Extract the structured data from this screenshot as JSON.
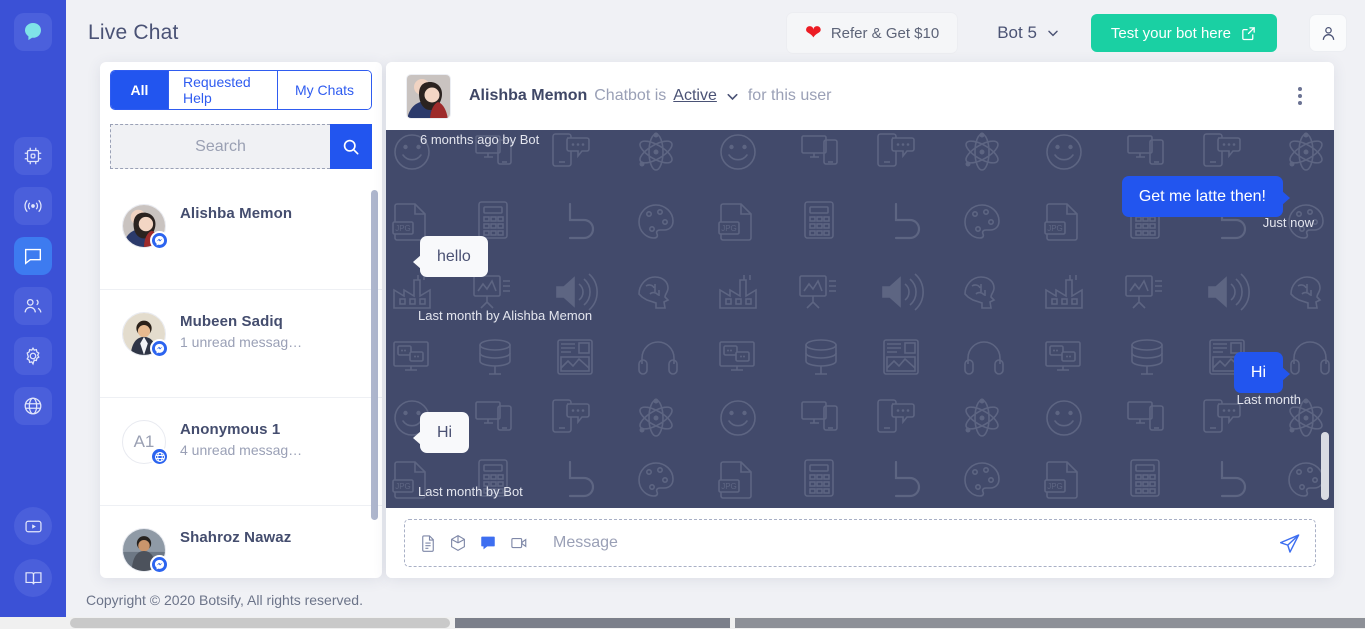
{
  "brand": {
    "logo_icon": "botsify-chat-bubble-logo",
    "accent_blue": "#2255ef",
    "rail_blue": "#3b51d6",
    "green": "#1ad0a3",
    "chat_bg": "#424a6b"
  },
  "nav": {
    "items": [
      {
        "label": "AI / Machine learning",
        "icon": "cpu-chip-icon",
        "active": false
      },
      {
        "label": "Broadcast",
        "icon": "broadcast-signal-icon",
        "active": false
      },
      {
        "label": "Live Chat",
        "icon": "chat-bubble-icon",
        "active": true
      },
      {
        "label": "Users",
        "icon": "users-icon",
        "active": false
      },
      {
        "label": "Settings",
        "icon": "gear-icon",
        "active": false
      },
      {
        "label": "Integrations",
        "icon": "globe-icon",
        "active": false
      }
    ],
    "bottom_items": [
      {
        "label": "Video tutorials",
        "icon": "video-play-icon"
      },
      {
        "label": "Documentation",
        "icon": "book-icon"
      }
    ]
  },
  "header": {
    "title": "Live Chat",
    "refer_label": "Refer & Get $10",
    "refer_icon": "heart-icon",
    "bot_name": "Bot 5",
    "bot_chevron_icon": "chevron-down-icon",
    "test_bot_label": "Test your bot here",
    "test_bot_icon": "external-link-icon",
    "account_icon": "user-person-icon"
  },
  "chat_list": {
    "tabs": [
      {
        "label": "All",
        "active": true
      },
      {
        "label": "Requested Help",
        "active": false
      },
      {
        "label": "My Chats",
        "active": false
      }
    ],
    "search": {
      "placeholder": "Search",
      "value": "",
      "button_icon": "search-icon"
    },
    "conversations": [
      {
        "name": "Alishba Memon",
        "sub": "",
        "channel_icon": "messenger-icon",
        "avatar_type": "photo",
        "initials": "",
        "selected": true
      },
      {
        "name": "Mubeen Sadiq",
        "sub": "1 unread messag…",
        "channel_icon": "messenger-icon",
        "avatar_type": "photo",
        "initials": "",
        "selected": false
      },
      {
        "name": "Anonymous 1",
        "sub": "4 unread messag…",
        "channel_icon": "globe-icon",
        "avatar_type": "initials",
        "initials": "A1",
        "selected": false
      },
      {
        "name": "Shahroz Nawaz",
        "sub": "",
        "channel_icon": "messenger-icon",
        "avatar_type": "photo",
        "initials": "",
        "selected": false
      }
    ]
  },
  "conversation": {
    "contact_name": "Alishba Memon",
    "status_prefix": "Chatbot is",
    "status_value": "Active",
    "status_suffix": "for this user",
    "status_chevron_icon": "chevron-down-icon",
    "menu_icon": "kebab-menu-icon",
    "messages": [
      {
        "id": "m0",
        "side": "left",
        "text": "",
        "stamp": "6 months ago by Bot",
        "stamp_only": true
      },
      {
        "id": "m1",
        "side": "left",
        "text": "hello",
        "stamp": "Last month by Alishba Memon"
      },
      {
        "id": "m2",
        "side": "right",
        "text": "Get me latte then!",
        "stamp": "Just now"
      },
      {
        "id": "m3",
        "side": "right",
        "text": "Hi",
        "stamp": "Last month"
      },
      {
        "id": "m4",
        "side": "left",
        "text": "Hi",
        "stamp": "Last month by Bot"
      }
    ],
    "composer": {
      "placeholder": "Message",
      "value": "",
      "attach_icons": [
        "file-document-icon",
        "box-3d-icon",
        "chat-template-icon",
        "video-camera-icon"
      ],
      "send_icon": "send-paper-plane-icon"
    }
  },
  "footer": {
    "copyright": "Copyright © 2020 Botsify, All rights reserved."
  }
}
